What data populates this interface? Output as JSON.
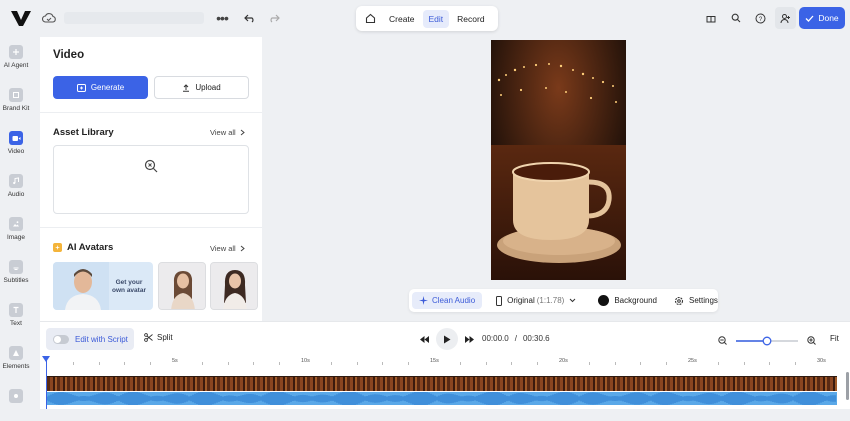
{
  "topbar": {
    "modes": [
      "Create",
      "Edit",
      "Record"
    ],
    "active_mode": "Edit",
    "done_label": "Done"
  },
  "rail": {
    "items": [
      {
        "label": "AI Agent",
        "icon": "ai-agent-icon"
      },
      {
        "label": "Brand Kit",
        "icon": "brand-kit-icon"
      },
      {
        "label": "Video",
        "icon": "video-icon",
        "active": true
      },
      {
        "label": "Audio",
        "icon": "audio-icon"
      },
      {
        "label": "Image",
        "icon": "image-icon"
      },
      {
        "label": "Subtitles",
        "icon": "subtitles-icon"
      },
      {
        "label": "Text",
        "icon": "text-icon"
      },
      {
        "label": "Elements",
        "icon": "elements-icon"
      }
    ]
  },
  "panel": {
    "title": "Video",
    "generate_label": "Generate",
    "upload_label": "Upload",
    "asset_library_title": "Asset Library",
    "view_all": "View all",
    "ai_avatars_title": "AI Avatars",
    "avatar_cta": "Get your own avatar"
  },
  "video_toolbar": {
    "clean_audio": "Clean Audio",
    "aspect": "Original",
    "aspect_ratio": "(1:1.78)",
    "background": "Background",
    "settings": "Settings"
  },
  "controls": {
    "edit_with_script": "Edit with Script",
    "split": "Split",
    "current_time": "00:00.0",
    "separator": "/",
    "total_time": "00:30.6",
    "fit": "Fit",
    "zoom_level": 0.5
  },
  "timeline": {
    "labels": [
      "5s",
      "10s",
      "15s",
      "20s",
      "25s",
      "30s"
    ]
  },
  "colors": {
    "accent": "#3b63e6",
    "audio_wave": "#5aa8e8"
  }
}
